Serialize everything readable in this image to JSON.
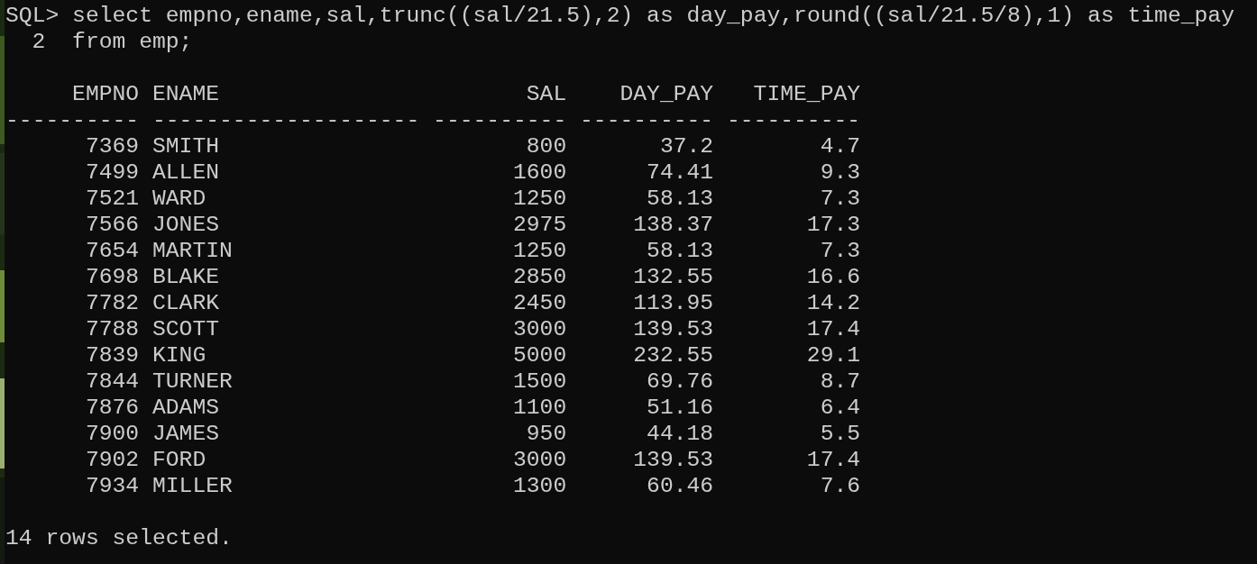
{
  "terminal": {
    "command_lines": [
      {
        "prompt": "SQL>",
        "text": "select empno,ename,sal,trunc((sal/21.5),2) as day_pay,round((sal/21.5/8),1) as time_pay"
      },
      {
        "prompt": "2",
        "text": "from emp;"
      }
    ],
    "table": {
      "columns": [
        {
          "header": "EMPNO",
          "rule": "----------",
          "kind": "number"
        },
        {
          "header": "ENAME",
          "rule": "--------------------",
          "kind": "text"
        },
        {
          "header": "SAL",
          "rule": "----------",
          "kind": "number"
        },
        {
          "header": "DAY_PAY",
          "rule": "----------",
          "kind": "number"
        },
        {
          "header": "TIME_PAY",
          "rule": "----------",
          "kind": "number"
        }
      ],
      "rows": [
        [
          "7369",
          "SMITH",
          "800",
          "37.2",
          "4.7"
        ],
        [
          "7499",
          "ALLEN",
          "1600",
          "74.41",
          "9.3"
        ],
        [
          "7521",
          "WARD",
          "1250",
          "58.13",
          "7.3"
        ],
        [
          "7566",
          "JONES",
          "2975",
          "138.37",
          "17.3"
        ],
        [
          "7654",
          "MARTIN",
          "1250",
          "58.13",
          "7.3"
        ],
        [
          "7698",
          "BLAKE",
          "2850",
          "132.55",
          "16.6"
        ],
        [
          "7782",
          "CLARK",
          "2450",
          "113.95",
          "14.2"
        ],
        [
          "7788",
          "SCOTT",
          "3000",
          "139.53",
          "17.4"
        ],
        [
          "7839",
          "KING",
          "5000",
          "232.55",
          "29.1"
        ],
        [
          "7844",
          "TURNER",
          "1500",
          "69.76",
          "8.7"
        ],
        [
          "7876",
          "ADAMS",
          "1100",
          "51.16",
          "6.4"
        ],
        [
          "7900",
          "JAMES",
          "950",
          "44.18",
          "5.5"
        ],
        [
          "7902",
          "FORD",
          "3000",
          "139.53",
          "17.4"
        ],
        [
          "7934",
          "MILLER",
          "1300",
          "60.46",
          "7.6"
        ]
      ]
    },
    "status_line": "14 rows selected."
  }
}
